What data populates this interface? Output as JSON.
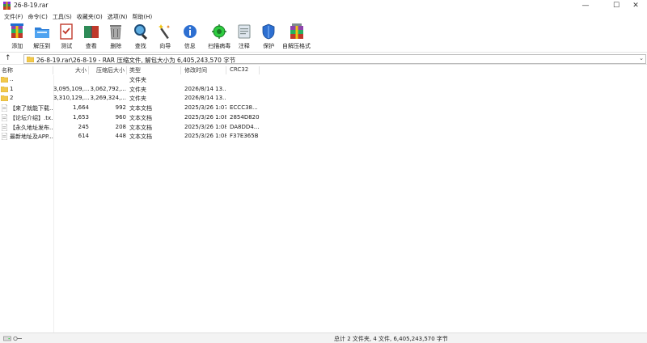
{
  "window": {
    "title": "26-8-19.rar",
    "minimize": "—",
    "maximize": "☐",
    "close": "✕"
  },
  "menu": [
    "文件(F)",
    "命令(C)",
    "工具(S)",
    "收藏夹(O)",
    "选项(N)",
    "帮助(H)"
  ],
  "toolbar": [
    {
      "label": "添加",
      "icon": "add-archive-icon"
    },
    {
      "label": "解压到",
      "icon": "extract-folder-icon"
    },
    {
      "label": "测试",
      "icon": "test-icon"
    },
    {
      "label": "查看",
      "icon": "view-book-icon"
    },
    {
      "label": "删除",
      "icon": "trash-icon"
    },
    {
      "label": "查找",
      "icon": "magnifier-icon"
    },
    {
      "label": "向导",
      "icon": "wand-icon"
    },
    {
      "label": "信息",
      "icon": "info-icon"
    },
    {
      "label": "扫描病毒",
      "icon": "virus-scan-icon"
    },
    {
      "label": "注释",
      "icon": "comment-icon"
    },
    {
      "label": "保护",
      "icon": "shield-icon"
    },
    {
      "label": "自解压格式",
      "icon": "sfx-icon"
    }
  ],
  "address": {
    "up": "↑",
    "path": "26-8-19.rar\\26-8-19 - RAR 压缩文件, 解包大小为 6,405,243,570 字节",
    "dropdown": "⌄"
  },
  "columns": {
    "name": "名称",
    "size": "大小",
    "packed": "压缩后大小",
    "type": "类型",
    "modified": "修改时间",
    "crc": "CRC32"
  },
  "files": [
    {
      "kind": "folder",
      "name": "..",
      "size": "",
      "packed": "",
      "type": "文件夹",
      "modified": "",
      "crc": ""
    },
    {
      "kind": "folder",
      "name": "1",
      "size": "3,095,109,...",
      "packed": "3,062,792,...",
      "type": "文件夹",
      "modified": "2026/8/14 13...",
      "crc": ""
    },
    {
      "kind": "folder",
      "name": "2",
      "size": "3,310,129,...",
      "packed": "3,269,324,...",
      "type": "文件夹",
      "modified": "2026/8/14 13...",
      "crc": ""
    },
    {
      "kind": "doc",
      "name": "【来了就能下载...",
      "size": "1,664",
      "packed": "992",
      "type": "文本文档",
      "modified": "2025/3/26 1:07",
      "crc": "ECCC38..."
    },
    {
      "kind": "doc",
      "name": "【论坛介绍】.tx...",
      "size": "1,653",
      "packed": "960",
      "type": "文本文档",
      "modified": "2025/3/26 1:08",
      "crc": "2854D820"
    },
    {
      "kind": "doc",
      "name": "【永久地址发布...",
      "size": "245",
      "packed": "208",
      "type": "文本文档",
      "modified": "2025/3/26 1:08",
      "crc": "DA8DD4..."
    },
    {
      "kind": "doc",
      "name": "最新地址及APP...",
      "size": "614",
      "packed": "448",
      "type": "文本文档",
      "modified": "2025/3/26 1:08",
      "crc": "F37E365B"
    }
  ],
  "status": {
    "summary": "总计 2 文件夹, 4 文件, 6,405,243,570 字节"
  },
  "colors": {
    "folder": "#f2c94c",
    "accent": "#1f6fd1",
    "statusbar": "#f3f3f3"
  }
}
